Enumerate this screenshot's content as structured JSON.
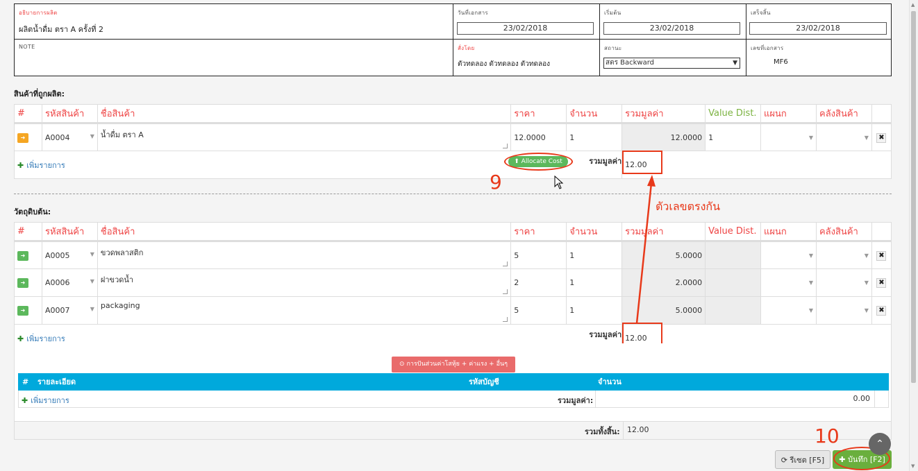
{
  "header": {
    "description_label": "อธิบายการผลิต",
    "description_value": "ผลิตน้ำดื่ม ตรา A ครั้งที่ 2",
    "doc_date_label": "วันที่เอกสาร",
    "doc_date_value": "23/02/2018",
    "start_label": "เริ่มต้น",
    "start_value": "23/02/2018",
    "finish_label": "เสร็จสิ้น",
    "finish_value": "23/02/2018",
    "note_label": "NOTE",
    "ordered_by_label": "สั่งโดย",
    "ordered_by_value": "ตัวทดลอง  ตัวทดลอง ตัวทดลอง",
    "status_label": "สถานะ",
    "status_value": "สตร Backward",
    "doc_no_label": "เลขที่เอกสาร",
    "doc_no_value": "MF6"
  },
  "columns": {
    "num": "#",
    "code": "รหัสสินค้า",
    "name": "ชื่อสินค้า",
    "price": "ราคา",
    "qty": "จำนวน",
    "total": "รวมมูลค่า",
    "value_dist": "Value Dist.",
    "dept": "แผนก",
    "warehouse": "คลังสินค้า"
  },
  "produced": {
    "title": "สินค้าที่ถูกผลิต:",
    "rows": [
      {
        "code": "A0004",
        "name": "น้ำดื่ม ตรา A",
        "price": "12.0000",
        "qty": "1",
        "total": "12.0000",
        "value_dist": "1"
      }
    ],
    "add_label": "เพิ่มรายการ",
    "allocate_label": "Allocate Cost",
    "total_label": "รวมมูลค่า",
    "total_value": "12.00"
  },
  "materials": {
    "title": "วัตถุดิบต้น:",
    "rows": [
      {
        "code": "A0005",
        "name": "ขวดพลาสติก",
        "price": "5",
        "qty": "1",
        "total": "5.0000"
      },
      {
        "code": "A0006",
        "name": "ฝาขวดน้ำ",
        "price": "2",
        "qty": "1",
        "total": "2.0000"
      },
      {
        "code": "A0007",
        "name": "packaging",
        "price": "5",
        "qty": "1",
        "total": "5.0000"
      }
    ],
    "add_label": "เพิ่มรายการ",
    "total_label": "รวมมูลค่า",
    "total_value": "12.00"
  },
  "overhead": {
    "button_label": "การปันส่วนค่าโสหุ้ย + ค่าแรง + อื่นๆ",
    "col_num": "#",
    "col_detail": "รายละเอียด",
    "col_account": "รหัสบัญชี",
    "col_amount": "จำนวน",
    "add_label": "เพิ่มรายการ",
    "total_label": "รวมมูลค่า:",
    "total_value": "0.00"
  },
  "grand_total_label": "รวมทั้งสิ้น:",
  "grand_total_value": "12.00",
  "buttons": {
    "reset": "รีเซต [F5]",
    "save": "บันทึก [F2]"
  },
  "annotations": {
    "step9": "9",
    "step10": "10",
    "match_note": "ตัวเลขตรงกัน"
  },
  "colors": {
    "accent_red": "#e8391a",
    "header_red": "#e44444",
    "green": "#7cb342",
    "blue_header": "#00a9dc"
  }
}
